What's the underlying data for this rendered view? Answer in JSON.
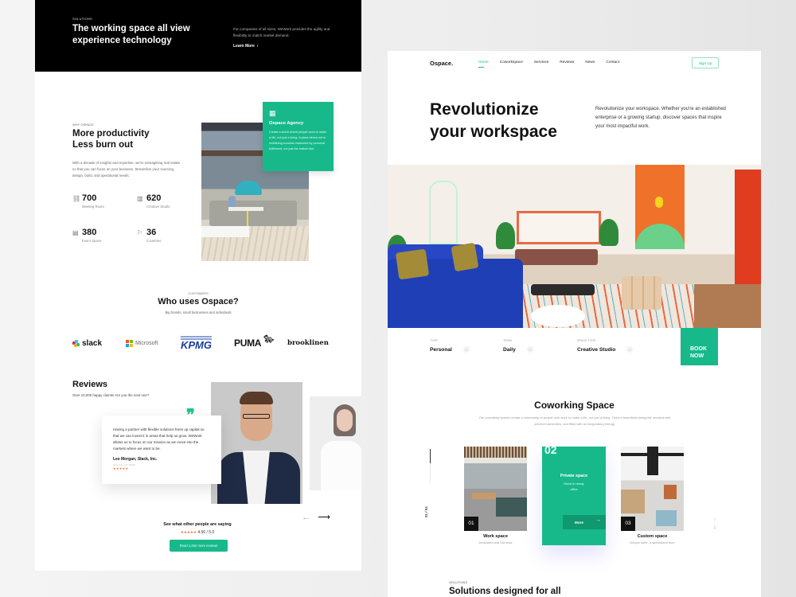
{
  "left_page": {
    "hero": {
      "eyebrow": "SOLUTIONS",
      "title": "The working space all view experience technology",
      "description": "For companies of all sizes, WeWork provides the agility and flexibility to match market demand.",
      "cta": "Learn More",
      "cta_icon": "chevron-right-icon"
    },
    "why": {
      "eyebrow": "WHY OSPACE",
      "title_line1": "More productivity",
      "title_line2": "Less burn out",
      "description": "With a decade of insights and expertise, we're reimagining real estate so that you can focus on your business. Streamline your sourcing, design, build, and operational needs.",
      "stats": [
        {
          "icon": "meeting-room-icon",
          "glyph": "⛓",
          "value": "700",
          "label": "Meeting Room"
        },
        {
          "icon": "building-icon",
          "glyph": "▥",
          "value": "620",
          "label": "Creative Studio"
        },
        {
          "icon": "event-space-icon",
          "glyph": "▤",
          "value": "380",
          "label": "Event Space"
        },
        {
          "icon": "flag-icon",
          "glyph": "⚐",
          "value": "36",
          "label": "Countries"
        }
      ]
    },
    "agency": {
      "icon": "building-icon",
      "title": "Ospace Agency",
      "description": "Create a world where people work to make a life, not just a living. A place where we're redefining success measured by personal fulfillment, not just the bottom line."
    },
    "customers": {
      "eyebrow": "CUSTOMERS",
      "title": "Who uses Ospace?",
      "subtitle": "Big brands, small businesses and individuals",
      "logos": [
        "slack",
        "Microsoft",
        "KPMG",
        "PUMA",
        "brooklinen"
      ]
    },
    "reviews": {
      "title": "Reviews",
      "subtitle": "Over 10,000 happy clients! Are you the next one?",
      "quote": "Having a partner with flexible solutions frees up capital so that we can invest it in areas that help us grow. WeWork allows us to focus on our mission as we move into the markets where we want to be.",
      "author": "Lee Morgan, Slack, Inc.",
      "author_location": "New York, NY 10018",
      "stars": "★★★★★",
      "see_more": "See what other people are saying",
      "rating_stars": "★★★★★",
      "rating": "4.56 / 5.0",
      "read_button": "Read 1,262 more reviews",
      "prev_icon": "←",
      "next_icon": "⟶"
    }
  },
  "right_page": {
    "brand": "Ospace.",
    "nav": [
      {
        "label": "Home",
        "active": true
      },
      {
        "label": "Coworkspace",
        "active": false
      },
      {
        "label": "Services",
        "active": false
      },
      {
        "label": "Reviews",
        "active": false
      },
      {
        "label": "News",
        "active": false
      },
      {
        "label": "Contact",
        "active": false
      }
    ],
    "signup": "Sign Up",
    "hero": {
      "title_line1": "Revolutionize",
      "title_line2": "your workspace",
      "description": "Revolutionize your workspace. Whether you're an established enterprise or a growing startup, discover spaces that inspire your most impactful work."
    },
    "booking": {
      "fields": [
        {
          "label": "TYPE",
          "value": "Personal"
        },
        {
          "label": "TERM",
          "value": "Daily"
        },
        {
          "label": "SPACE TYPE",
          "value": "Creative Studio"
        }
      ],
      "button_line1": "BOOK",
      "button_line2": "NOW"
    },
    "coworking": {
      "title": "Coworking Space",
      "description": "Our coworking spaces create a community of people who work to make a life, not just a living. They're beautifully designed, stocked with premium amenities, and filled with an invigorating energy.",
      "slider_counter": "01 / 04",
      "cards": [
        {
          "num": "01",
          "title": "Work space",
          "subtitle": "Dedicated and hot desk"
        },
        {
          "num": "02",
          "title": "Private space",
          "subtitle": "Move-in ready office",
          "button": "More",
          "button_icon": "→"
        },
        {
          "num": "03",
          "title": "Custom space",
          "subtitle": "Unique suite, a specialized floor"
        }
      ],
      "up_icon": "↑",
      "down_icon": "↓"
    },
    "solutions": {
      "eyebrow": "SOLUTIONS",
      "title": "Solutions designed for all"
    }
  },
  "colors": {
    "accent": "#17b98a",
    "dark": "#000000",
    "star": "#f26b2c"
  }
}
